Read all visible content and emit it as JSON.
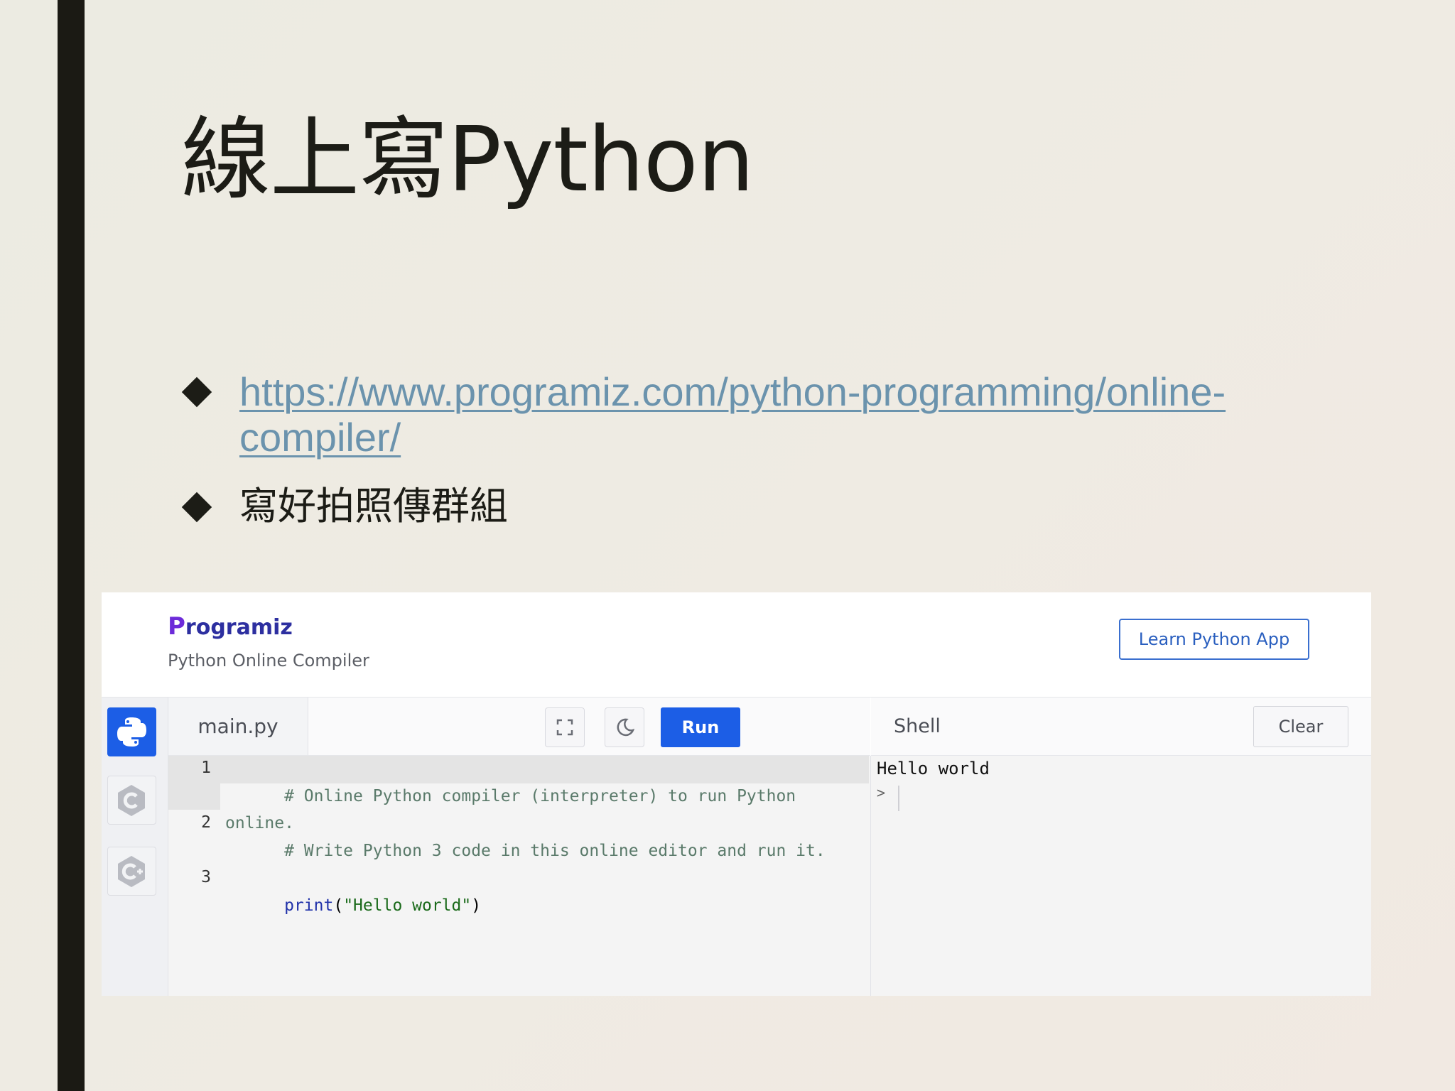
{
  "slide": {
    "title": "線上寫Python",
    "bullets": [
      {
        "text": "https://www.programiz.com/python-programming/online-compiler/",
        "type": "link"
      },
      {
        "text": "寫好拍照傳群組",
        "type": "text"
      }
    ]
  },
  "header": {
    "logo": "Programiz",
    "logo_first": "P",
    "logo_rest": "rogramiz",
    "subtitle": "Python Online Compiler",
    "learn_button": "Learn Python App"
  },
  "languages": [
    {
      "name": "python-icon",
      "active": true
    },
    {
      "name": "c-icon",
      "active": false
    },
    {
      "name": "cpp-icon",
      "active": false
    }
  ],
  "toolbar": {
    "tab": "main.py",
    "run_label": "Run"
  },
  "editor": {
    "lines": [
      {
        "num": "1",
        "text": "# Online Python compiler (interpreter) to run Python online."
      },
      {
        "num": "2",
        "text": "# Write Python 3 code in this online editor and run it."
      },
      {
        "num": "3",
        "kw": "print",
        "paren_open": "(",
        "str": "\"Hello world\"",
        "paren_close": ")"
      }
    ]
  },
  "shell": {
    "label": "Shell",
    "clear_label": "Clear",
    "output": "Hello world",
    "prompt": ">"
  },
  "colors": {
    "accent": "#1c5ee6",
    "link": "#6b93ad",
    "logo": "#2d2fa0"
  }
}
